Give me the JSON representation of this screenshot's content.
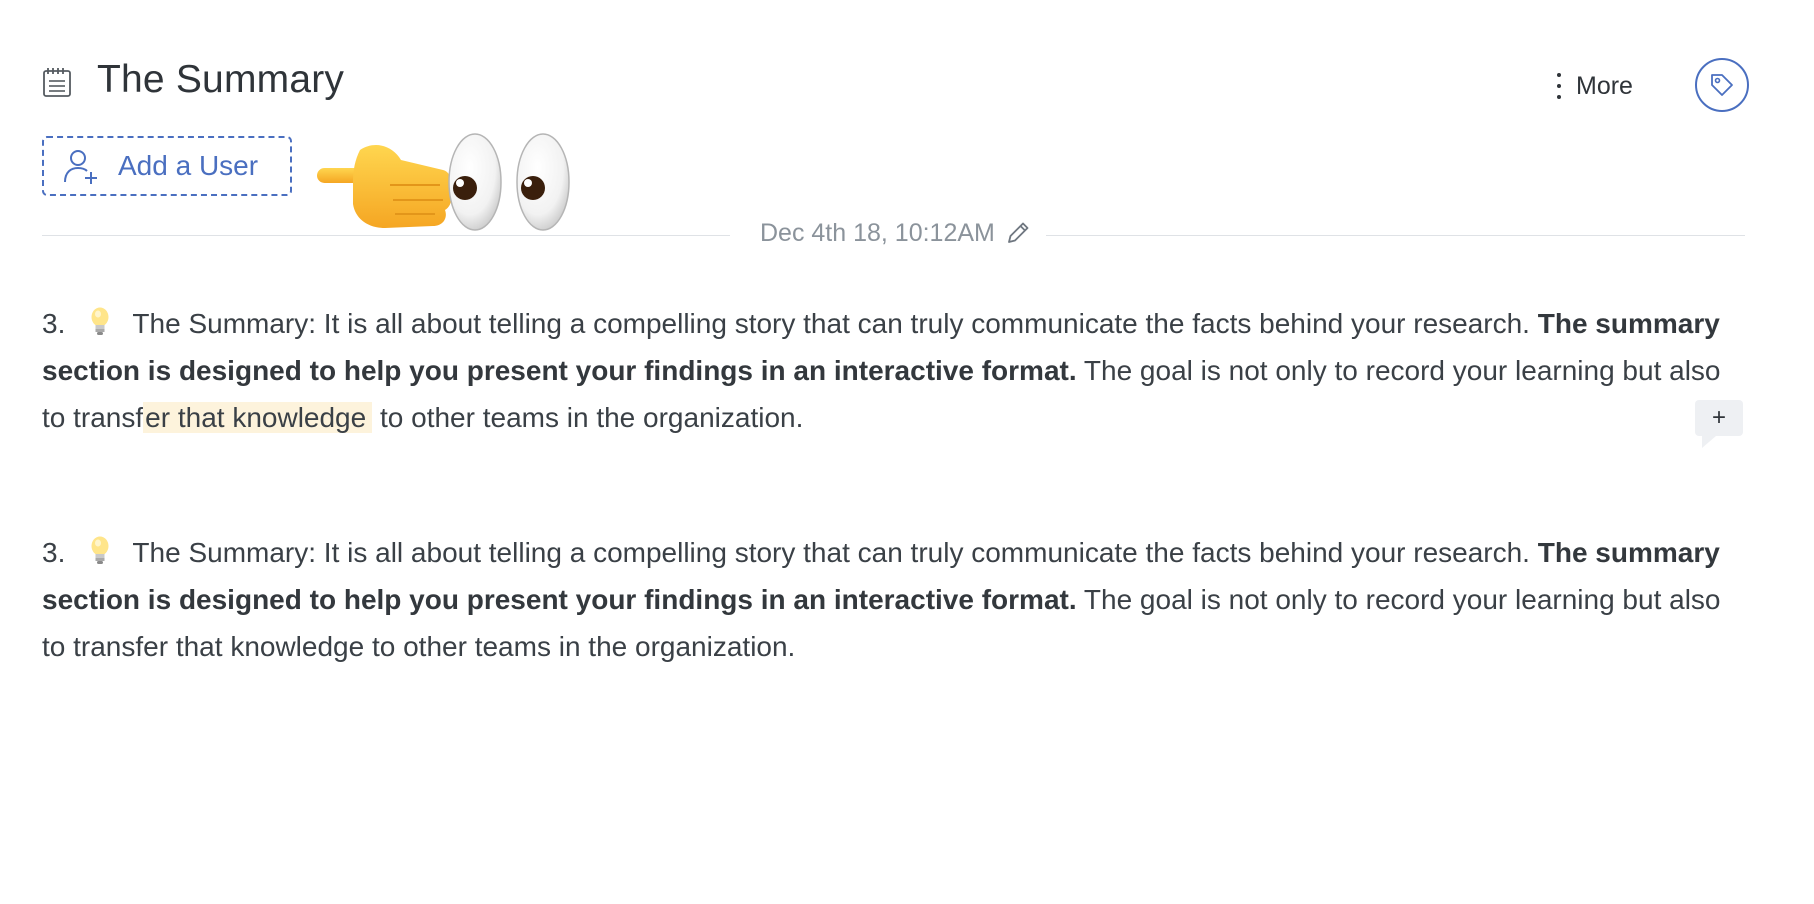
{
  "header": {
    "title": "The Summary",
    "more_label": "More",
    "doc_icon": "notebook-icon",
    "tag_icon": "tag-icon"
  },
  "toolbar": {
    "add_user_label": "Add a User",
    "add_user_icon": "add-user-icon"
  },
  "emoji": [
    "👉",
    "👀"
  ],
  "meta": {
    "date": "Dec 4th 18, 10:12AM",
    "edit_icon": "pencil-icon"
  },
  "paragraphs": [
    {
      "num": "3.",
      "icon": "lightbulb-icon",
      "lead": "The Summary: It is all about telling a compelling story that can truly communicate the facts behind your research.",
      "bold": "The summary section is designed to help you present your findings in an interactive format.",
      "tail_a": "The goal is not only to record your learning but also to transf",
      "highlight": "er that knowledge",
      "tail_b": "to other teams in the organization."
    },
    {
      "num": "3.",
      "icon": "lightbulb-icon",
      "lead": "The Summary: It is all about telling a compelling story that can truly communicate the facts behind your research.",
      "bold": "The summary section is designed to help you present your findings in an interactive format.",
      "tail": "The goal is not only to record your learning but also to transfer that knowledge to other teams in the organization."
    }
  ],
  "comment_button_label": "+",
  "colors": {
    "accent": "#4a6fc0",
    "highlight": "#fdf3dc",
    "muted_text": "#8b939b",
    "divider": "#dfe2e6"
  }
}
